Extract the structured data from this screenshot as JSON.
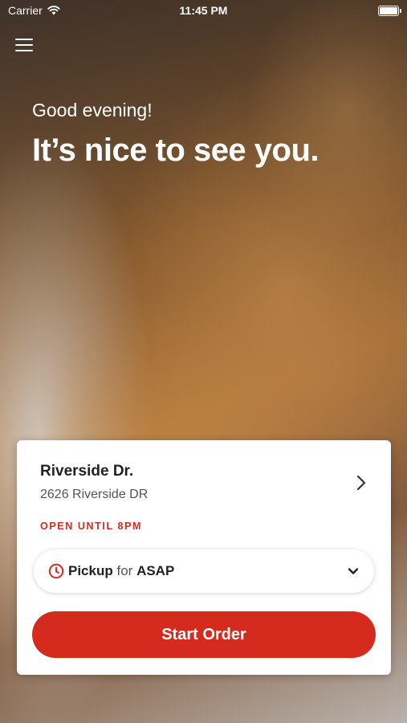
{
  "status_bar": {
    "carrier": "Carrier",
    "time": "11:45 PM"
  },
  "greeting": "Good evening!",
  "headline": "It’s nice to see you.",
  "store": {
    "name": "Riverside Dr.",
    "address": "2626 Riverside DR",
    "hours": "OPEN UNTIL 8PM"
  },
  "pickup": {
    "mode": "Pickup",
    "for": "for",
    "time": "ASAP"
  },
  "start_order_label": "Start Order",
  "colors": {
    "accent": "#d52b1e"
  },
  "icons": [
    "wifi-icon",
    "battery-icon",
    "menu-icon",
    "chevron-right-icon",
    "clock-icon",
    "chevron-down-icon"
  ]
}
